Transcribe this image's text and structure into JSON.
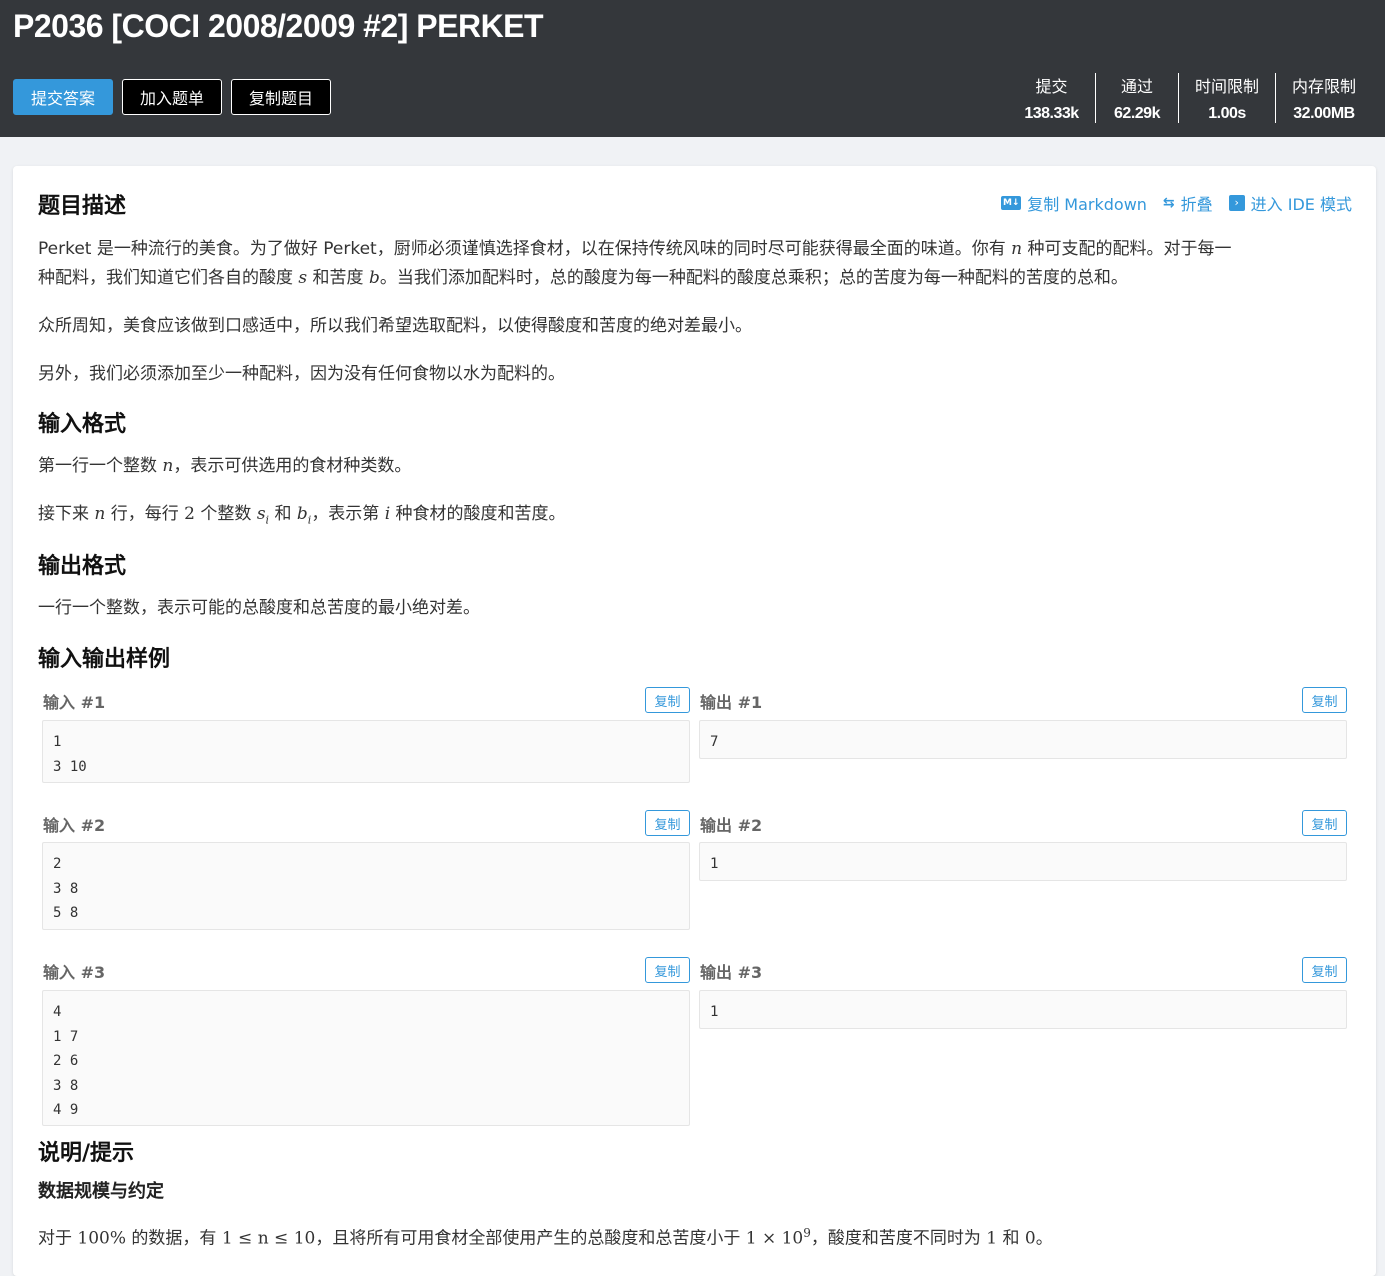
{
  "header": {
    "title": "P2036 [COCI 2008/2009 #2] PERKET",
    "buttons": {
      "submit": "提交答案",
      "add_list": "加入题单",
      "copy_problem": "复制题目"
    },
    "stats": [
      {
        "label": "提交",
        "value": "138.33k"
      },
      {
        "label": "通过",
        "value": "62.29k"
      },
      {
        "label": "时间限制",
        "value": "1.00s"
      },
      {
        "label": "内存限制",
        "value": "32.00MB"
      }
    ]
  },
  "tools": {
    "copy_md": "复制 Markdown",
    "md_icon": "M↓",
    "fold": "折叠",
    "ide": "进入 IDE 模式"
  },
  "sections": {
    "desc_title": "题目描述",
    "desc_p1a": "Perket 是一种流行的美食。为了做好 Perket，厨师必须谨慎选择食材，以在保持传统风味的同时尽可能获得最全面的味道。你有 ",
    "desc_p1b": " 种可支配的配料。对于每一",
    "desc_p1c": "种配料，我们知道它们各自的酸度 ",
    "desc_p1d": " 和苦度 ",
    "desc_p1e": "。当我们添加配料时，总的酸度为每一种配料的酸度总乘积；总的苦度为每一种配料的苦度的总和。",
    "desc_p2": "众所周知，美食应该做到口感适中，所以我们希望选取配料，以使得酸度和苦度的绝对差最小。",
    "desc_p3": "另外，我们必须添加至少一种配料，因为没有任何食物以水为配料的。",
    "input_title": "输入格式",
    "input_p1a": "第一行一个整数 ",
    "input_p1b": "，表示可供选用的食材种类数。",
    "input_p2a": "接下来 ",
    "input_p2b": " 行，每行 ",
    "input_p2c": " 个整数 ",
    "input_p2d": " 和 ",
    "input_p2e": "，表示第 ",
    "input_p2f": " 种食材的酸度和苦度。",
    "output_title": "输出格式",
    "output_p1": "一行一个整数，表示可能的总酸度和总苦度的最小绝对差。",
    "samples_title": "输入输出样例",
    "hint_title": "说明/提示",
    "scale_title": "数据规模与约定",
    "scale_a": "对于 ",
    "scale_b": " 的数据，有 ",
    "scale_c": "，且将所有可用食材全部使用产生的总酸度和总苦度小于 ",
    "scale_d": "，酸度和苦度不同时为 ",
    "scale_e": " 和 ",
    "scale_f": "。"
  },
  "math": {
    "n": "n",
    "s": "s",
    "b": "b",
    "two": "2",
    "si": "s",
    "bi": "b",
    "sub_i": "i",
    "i": "i",
    "pct": "100%",
    "range": "1 ≤ n ≤ 10",
    "bound": "1 × 10",
    "exp": "9",
    "one": "1",
    "zero": "0"
  },
  "samples": [
    {
      "in_label": "输入 #1",
      "out_label": "输出 #1",
      "input": "1\n3 10",
      "output": "7"
    },
    {
      "in_label": "输入 #2",
      "out_label": "输出 #2",
      "input": "2\n3 8\n5 8",
      "output": "1"
    },
    {
      "in_label": "输入 #3",
      "out_label": "输出 #3",
      "input": "4\n1 7\n2 6\n3 8\n4 9",
      "output": "1"
    }
  ],
  "copy_label": "复制"
}
